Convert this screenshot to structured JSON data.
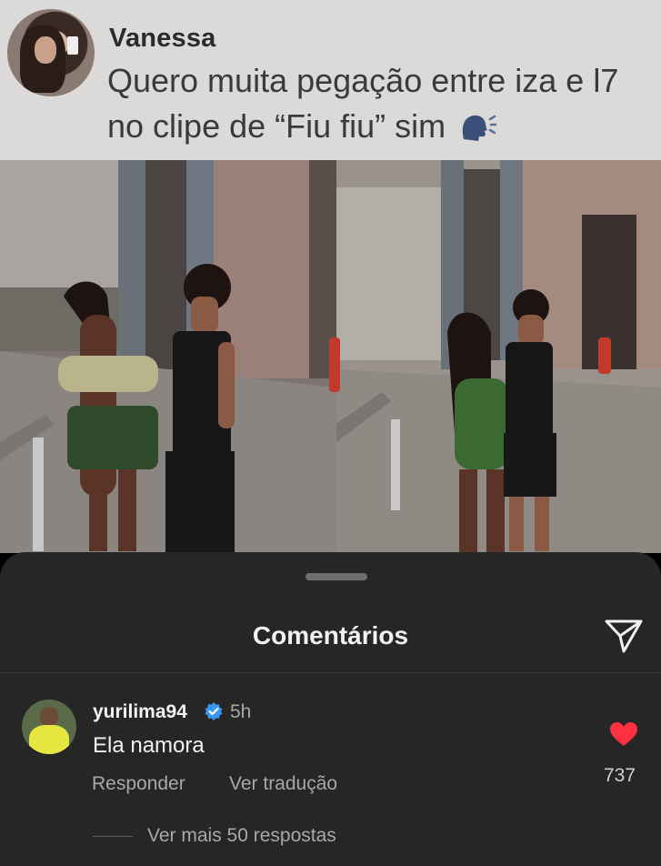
{
  "tweet": {
    "author": "Vanessa",
    "text": "Quero muita pegação entre iza e l7 no clipe de “Fiu fiu” sim",
    "emoji_icon": "speaking-head-icon"
  },
  "comments_sheet": {
    "title": "Comentários",
    "share_icon": "send-icon",
    "comment": {
      "username": "yurilima94",
      "verified": true,
      "time": "5h",
      "text": "Ela namora",
      "reply_label": "Responder",
      "translate_label": "Ver tradução",
      "like_count": "737",
      "liked": true,
      "view_more_label": "Ver mais 50 respostas"
    }
  },
  "colors": {
    "sheet_background": "#262626",
    "like_red": "#ff3040",
    "verified_blue": "#3897f0",
    "tweet_background": "#dcdad8"
  }
}
